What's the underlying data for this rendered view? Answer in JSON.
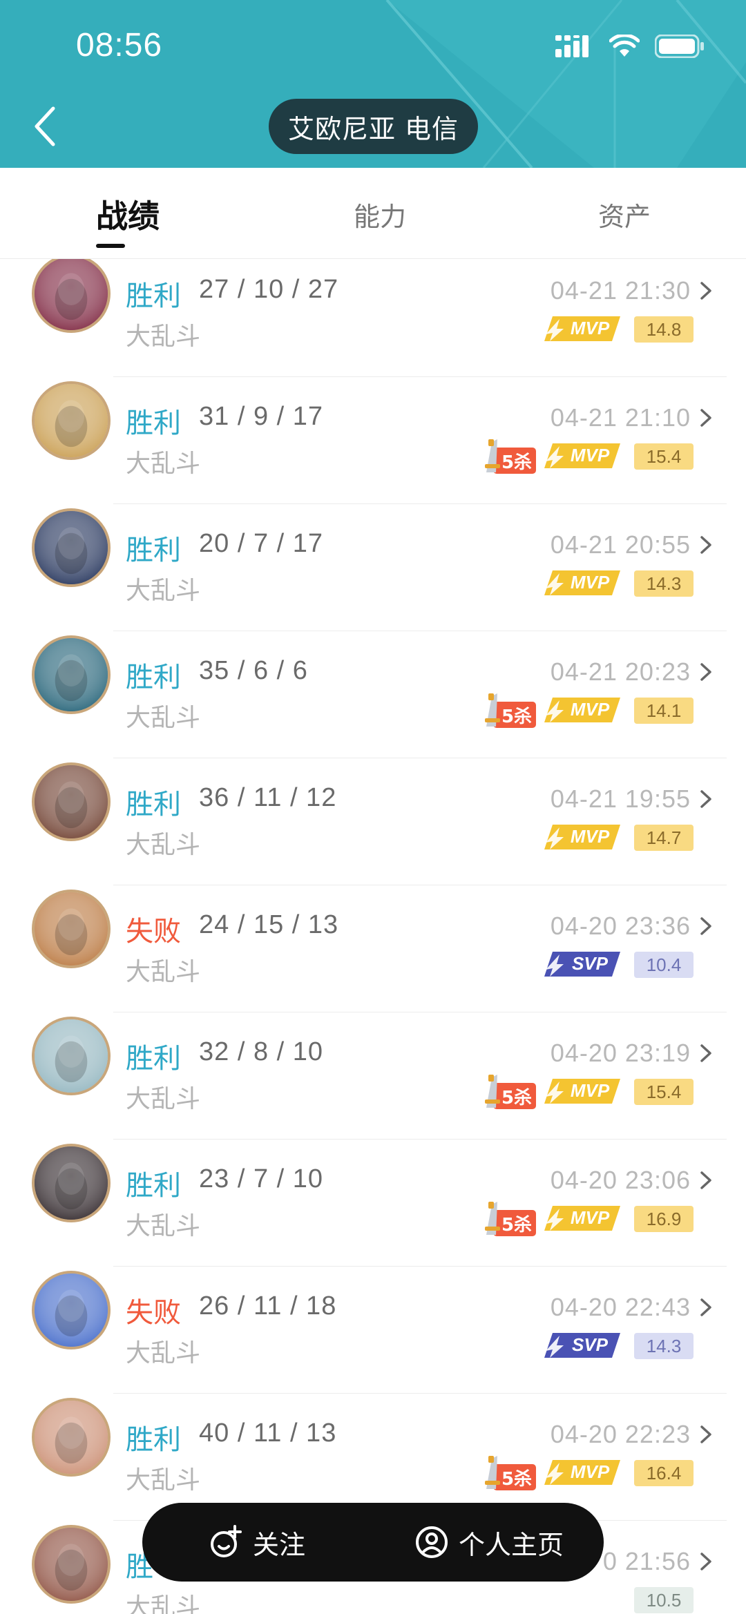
{
  "status_bar": {
    "time": "08:56"
  },
  "header": {
    "server": "艾欧尼亚 电信"
  },
  "tabs": [
    {
      "label": "战绩",
      "active": true
    },
    {
      "label": "能力",
      "active": false
    },
    {
      "label": "资产",
      "active": false
    }
  ],
  "badge_labels": {
    "five_kill": "5杀",
    "mvp": "MVP",
    "svp": "SVP"
  },
  "matches": [
    {
      "result": "胜利",
      "win": true,
      "kda": "27 / 10 / 27",
      "mode": "大乱斗",
      "time": "04-21 21:30",
      "five_kill": false,
      "badge": "mvp",
      "score": "14.8",
      "avatar_color": "#7a1f3a"
    },
    {
      "result": "胜利",
      "win": true,
      "kda": "31 / 9 / 17",
      "mode": "大乱斗",
      "time": "04-21 21:10",
      "five_kill": true,
      "badge": "mvp",
      "score": "15.4",
      "avatar_color": "#c79a4a"
    },
    {
      "result": "胜利",
      "win": true,
      "kda": "20 / 7 / 17",
      "mode": "大乱斗",
      "time": "04-21 20:55",
      "five_kill": false,
      "badge": "mvp",
      "score": "14.3",
      "avatar_color": "#1c2c55"
    },
    {
      "result": "胜利",
      "win": true,
      "kda": "35 / 6 / 6",
      "mode": "大乱斗",
      "time": "04-21 20:23",
      "five_kill": true,
      "badge": "mvp",
      "score": "14.1",
      "avatar_color": "#1b5c72"
    },
    {
      "result": "胜利",
      "win": true,
      "kda": "36 / 11 / 12",
      "mode": "大乱斗",
      "time": "04-21 19:55",
      "five_kill": false,
      "badge": "mvp",
      "score": "14.7",
      "avatar_color": "#6b3a2a"
    },
    {
      "result": "失败",
      "win": false,
      "kda": "24 / 15 / 13",
      "mode": "大乱斗",
      "time": "04-20 23:36",
      "five_kill": false,
      "badge": "svp",
      "score": "10.4",
      "avatar_color": "#b8743a"
    },
    {
      "result": "胜利",
      "win": true,
      "kda": "32 / 8 / 10",
      "mode": "大乱斗",
      "time": "04-20 23:19",
      "five_kill": true,
      "badge": "mvp",
      "score": "15.4",
      "avatar_color": "#8fb3bd"
    },
    {
      "result": "胜利",
      "win": true,
      "kda": "23 / 7 / 10",
      "mode": "大乱斗",
      "time": "04-20 23:06",
      "five_kill": true,
      "badge": "mvp",
      "score": "16.9",
      "avatar_color": "#2a2024"
    },
    {
      "result": "失败",
      "win": false,
      "kda": "26 / 11 / 18",
      "mode": "大乱斗",
      "time": "04-20 22:43",
      "five_kill": false,
      "badge": "svp",
      "score": "14.3",
      "avatar_color": "#3e66c8"
    },
    {
      "result": "胜利",
      "win": true,
      "kda": "40 / 11 / 13",
      "mode": "大乱斗",
      "time": "04-20 22:23",
      "five_kill": true,
      "badge": "mvp",
      "score": "16.4",
      "avatar_color": "#c98a6e"
    },
    {
      "result": "胜",
      "win": true,
      "kda": "",
      "mode": "大乱斗",
      "time": "0 21:56",
      "five_kill": false,
      "badge": "none",
      "score": "10.5",
      "avatar_color": "#8a4a3a"
    }
  ],
  "bottom_bar": {
    "follow": "关注",
    "profile": "个人主页"
  },
  "colors": {
    "header_bg": "#35aebb",
    "win": "#2fa8c7",
    "lose": "#f05a3c",
    "mvp_gold": "#f4c431",
    "svp_blue": "#4a52b4"
  }
}
